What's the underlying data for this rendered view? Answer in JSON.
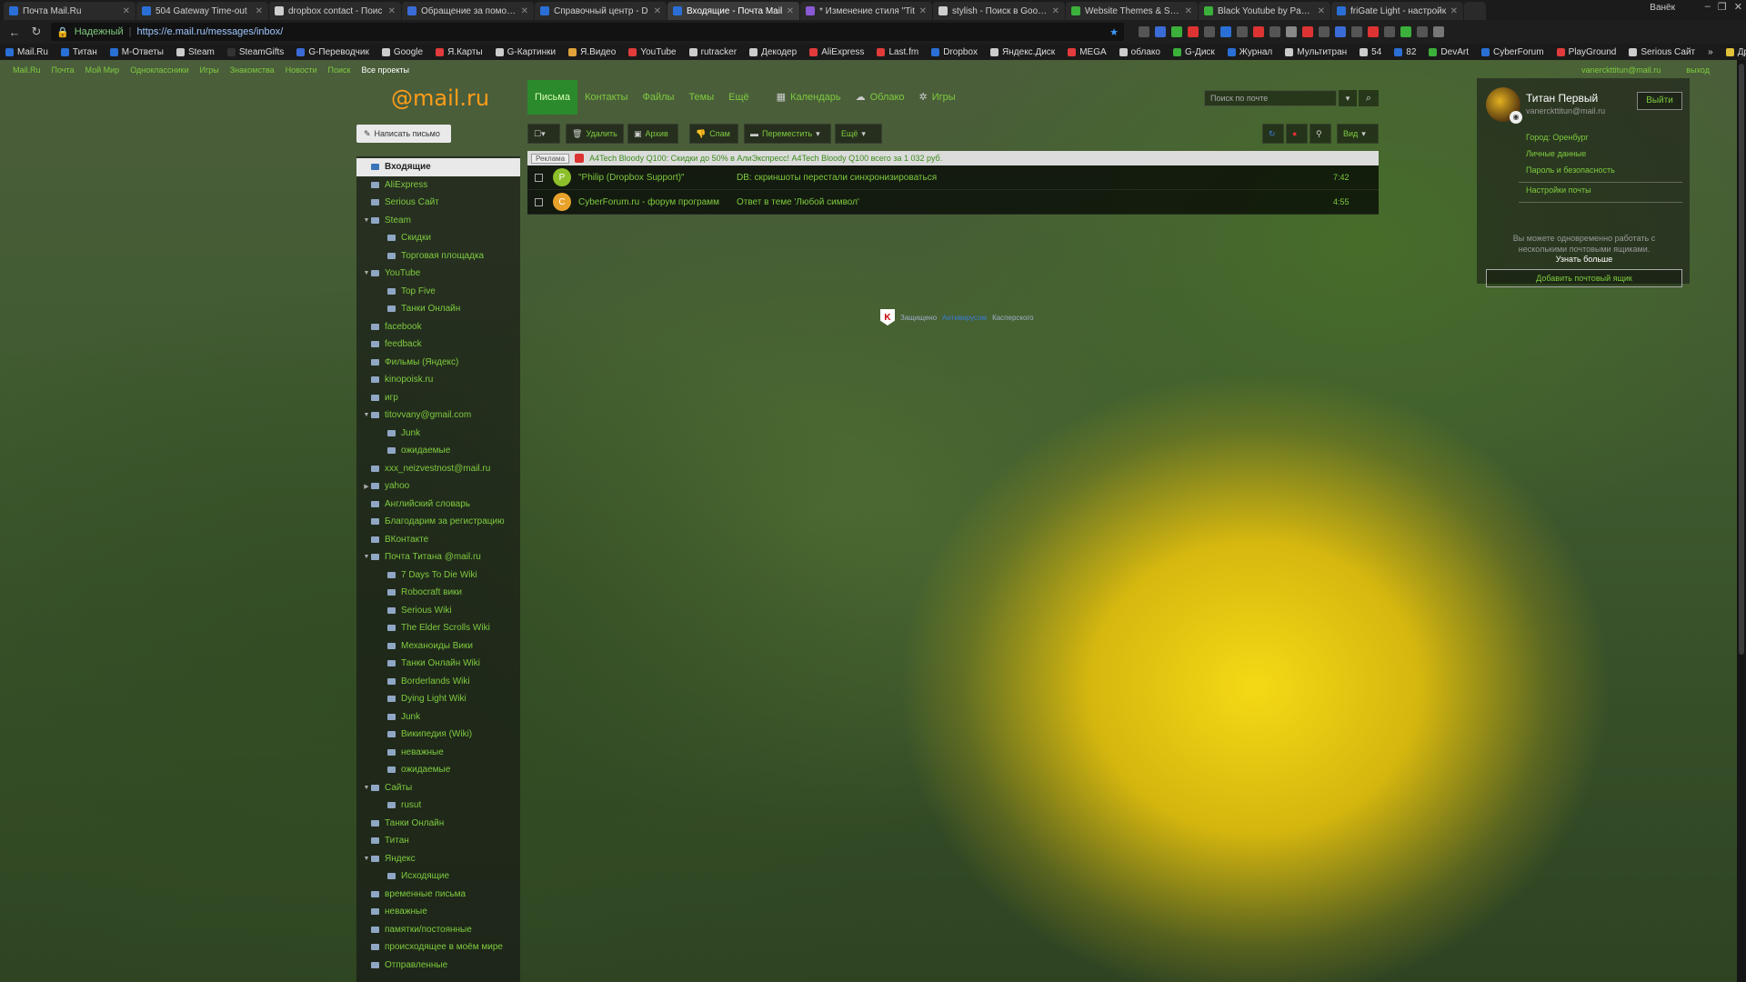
{
  "browser": {
    "tabs": [
      {
        "title": "Почта Mail.Ru",
        "color": "#2a6fd6"
      },
      {
        "title": "504 Gateway Time-out",
        "color": "#2a6fd6"
      },
      {
        "title": "dropbox contact - Поис",
        "color": "#cfcfcf"
      },
      {
        "title": "Обращение за помощь",
        "color": "#3b6bd6"
      },
      {
        "title": "Справочный центр - D",
        "color": "#2a6fd6"
      },
      {
        "title": "Входящие - Почта Mail",
        "color": "#2a6fd6"
      },
      {
        "title": "* Изменение стиля \"Tit",
        "color": "#8a5ad6"
      },
      {
        "title": "stylish - Поиск в Google",
        "color": "#cfcfcf"
      },
      {
        "title": "Website Themes & Skin",
        "color": "#3bb03b"
      },
      {
        "title": "Black Youtube by Panos",
        "color": "#3bb03b"
      },
      {
        "title": "friGate Light - настройк",
        "color": "#2a6fd6"
      }
    ],
    "window_user": "Ванёк",
    "secure_label": "Надежный",
    "url": "https://e.mail.ru/messages/inbox/",
    "bookmarks": [
      {
        "label": "Mail.Ru",
        "color": "#2a6fd6"
      },
      {
        "label": "Титан",
        "color": "#2a6fd6"
      },
      {
        "label": "М-Ответы",
        "color": "#2a6fd6"
      },
      {
        "label": "Steam",
        "color": "#cccccc"
      },
      {
        "label": "SteamGifts",
        "color": "#333333"
      },
      {
        "label": "G-Переводчик",
        "color": "#3b6bd6"
      },
      {
        "label": "Google",
        "color": "#cccccc"
      },
      {
        "label": "Я.Карты",
        "color": "#e23b3b"
      },
      {
        "label": "G-Картинки",
        "color": "#cccccc"
      },
      {
        "label": "Я.Видео",
        "color": "#e2a23b"
      },
      {
        "label": "YouTube",
        "color": "#e23b3b"
      },
      {
        "label": "rutracker",
        "color": "#cccccc"
      },
      {
        "label": "Декодер",
        "color": "#cccccc"
      },
      {
        "label": "AliExpress",
        "color": "#e23b3b"
      },
      {
        "label": "Last.fm",
        "color": "#e23b3b"
      },
      {
        "label": "Dropbox",
        "color": "#2a6fd6"
      },
      {
        "label": "Яндекс.Диск",
        "color": "#cccccc"
      },
      {
        "label": "MEGA",
        "color": "#e23b3b"
      },
      {
        "label": "облако",
        "color": "#cccccc"
      },
      {
        "label": "G-Диск",
        "color": "#3bb03b"
      },
      {
        "label": "Журнал",
        "color": "#2a6fd6"
      },
      {
        "label": "Мультитран",
        "color": "#cccccc"
      },
      {
        "label": "54",
        "color": "#cccccc"
      },
      {
        "label": "82",
        "color": "#2a6fd6"
      },
      {
        "label": "DevArt",
        "color": "#3bb03b"
      },
      {
        "label": "CyberForum",
        "color": "#2a6fd6"
      },
      {
        "label": "PlayGround",
        "color": "#e23b3b"
      },
      {
        "label": "Serious Сайт",
        "color": "#cccccc"
      }
    ],
    "more_bookmarks": "»",
    "other_bookmarks": "Другие закладки"
  },
  "portal": {
    "nav": [
      "Mail.Ru",
      "Почта",
      "Мой Мир",
      "Одноклассники",
      "Игры",
      "Знакомства",
      "Новости",
      "Поиск",
      "Все проекты"
    ],
    "user_email": "vanerckttitun@mail.ru",
    "logout": "выход"
  },
  "logo": {
    "text": "@mail",
    "suffix": ".ru"
  },
  "mainnav": {
    "items": [
      "Письма",
      "Контакты",
      "Файлы",
      "Темы",
      "Ещё"
    ],
    "calendar": "Календарь",
    "cloud": "Облако",
    "games": "Игры"
  },
  "search": {
    "placeholder": "Поиск по почте"
  },
  "compose": {
    "label": "Написать письмо"
  },
  "toolbar": {
    "delete": "Удалить",
    "archive": "Архив",
    "spam": "Спам",
    "move": "Переместить",
    "more": "Ещё",
    "view": "Вид"
  },
  "folders": [
    {
      "name": "Входящие",
      "level": 1,
      "selected": true,
      "expandable": false
    },
    {
      "name": "AliExpress",
      "level": 1,
      "expandable": false
    },
    {
      "name": "Serious Сайт",
      "level": 1,
      "expandable": false
    },
    {
      "name": "Steam",
      "level": 1,
      "expandable": true
    },
    {
      "name": "Скидки",
      "level": 2
    },
    {
      "name": "Торговая площадка",
      "level": 2
    },
    {
      "name": "YouTube",
      "level": 1,
      "expandable": true
    },
    {
      "name": "Top Five",
      "level": 2
    },
    {
      "name": "Танки Онлайн",
      "level": 2
    },
    {
      "name": "facebook",
      "level": 1
    },
    {
      "name": "feedback",
      "level": 1
    },
    {
      "name": "Фильмы (Яндекс)",
      "level": 1
    },
    {
      "name": "kinopoisk.ru",
      "level": 1
    },
    {
      "name": "игр",
      "level": 1
    },
    {
      "name": "titovvany@gmail.com",
      "level": 1,
      "expandable": true
    },
    {
      "name": "Junk",
      "level": 2
    },
    {
      "name": "ожидаемые",
      "level": 2
    },
    {
      "name": "xxx_neizvestnost@mail.ru",
      "level": 1
    },
    {
      "name": "yahoo",
      "level": 1,
      "expandable": true,
      "collapsed": true
    },
    {
      "name": "Английский словарь",
      "level": 1
    },
    {
      "name": "Благодарим за регистрацию",
      "level": 1
    },
    {
      "name": "ВКонтакте",
      "level": 1
    },
    {
      "name": "Почта Титана @mail.ru",
      "level": 1,
      "expandable": true
    },
    {
      "name": "7 Days To Die Wiki",
      "level": 2
    },
    {
      "name": "Robocraft вики",
      "level": 2
    },
    {
      "name": "Serious Wiki",
      "level": 2
    },
    {
      "name": "The Elder Scrolls Wiki",
      "level": 2
    },
    {
      "name": "Механоиды Вики",
      "level": 2
    },
    {
      "name": "Танки Онлайн Wiki",
      "level": 2
    },
    {
      "name": "Borderlands Wiki",
      "level": 2
    },
    {
      "name": "Dying Light Wiki",
      "level": 2
    },
    {
      "name": "Junk",
      "level": 2
    },
    {
      "name": "Википедия (Wiki)",
      "level": 2
    },
    {
      "name": "неважные",
      "level": 2
    },
    {
      "name": "ожидаемые",
      "level": 2
    },
    {
      "name": "Сайты",
      "level": 1,
      "expandable": true
    },
    {
      "name": "rusut",
      "level": 2
    },
    {
      "name": "Танки Онлайн",
      "level": 1
    },
    {
      "name": "Титан",
      "level": 1
    },
    {
      "name": "Яндекс",
      "level": 1,
      "expandable": true
    },
    {
      "name": "Исходящие",
      "level": 2
    },
    {
      "name": "временные письма",
      "level": 1
    },
    {
      "name": "неважные",
      "level": 1
    },
    {
      "name": "памятки/постоянные",
      "level": 1
    },
    {
      "name": "происходящее в моём мире",
      "level": 1
    },
    {
      "name": "Отправленные",
      "level": 1
    }
  ],
  "ad": {
    "label": "Реклама",
    "text": "A4Tech Bloody Q100: Скидки до 50% в АлиЭкспресс! A4Tech Bloody Q100 всего за 1 032 руб."
  },
  "messages": [
    {
      "avatar_letter": "P",
      "avatar_color": "#8cbf2a",
      "from": "\"Philip (Dropbox Support)\"",
      "subject": "DB: скриншоты перестали синхронизироваться",
      "time": "7:42"
    },
    {
      "avatar_letter": "C",
      "avatar_color": "#e8a22a",
      "from": "CyberForum.ru - форум программ",
      "subject": "Ответ в теме 'Любой символ'",
      "time": "4:55"
    }
  ],
  "kaspersky": {
    "prefix": "Защищено",
    "link": "Антивирусом",
    "suffix": "Касперского"
  },
  "user_panel": {
    "name": "Титан Первый",
    "email": "vanerckttitun@mail.ru",
    "logout": "Выйти",
    "city": "Город: Оренбург",
    "links": [
      "Личные данные",
      "Пароль и безопасность",
      "Настройки почты"
    ],
    "multi_text": "Вы можете одновременно работать с несколькими почтовыми ящиками.",
    "learn_more": "Узнать больше",
    "add_mailbox": "Добавить почтовый ящик"
  }
}
